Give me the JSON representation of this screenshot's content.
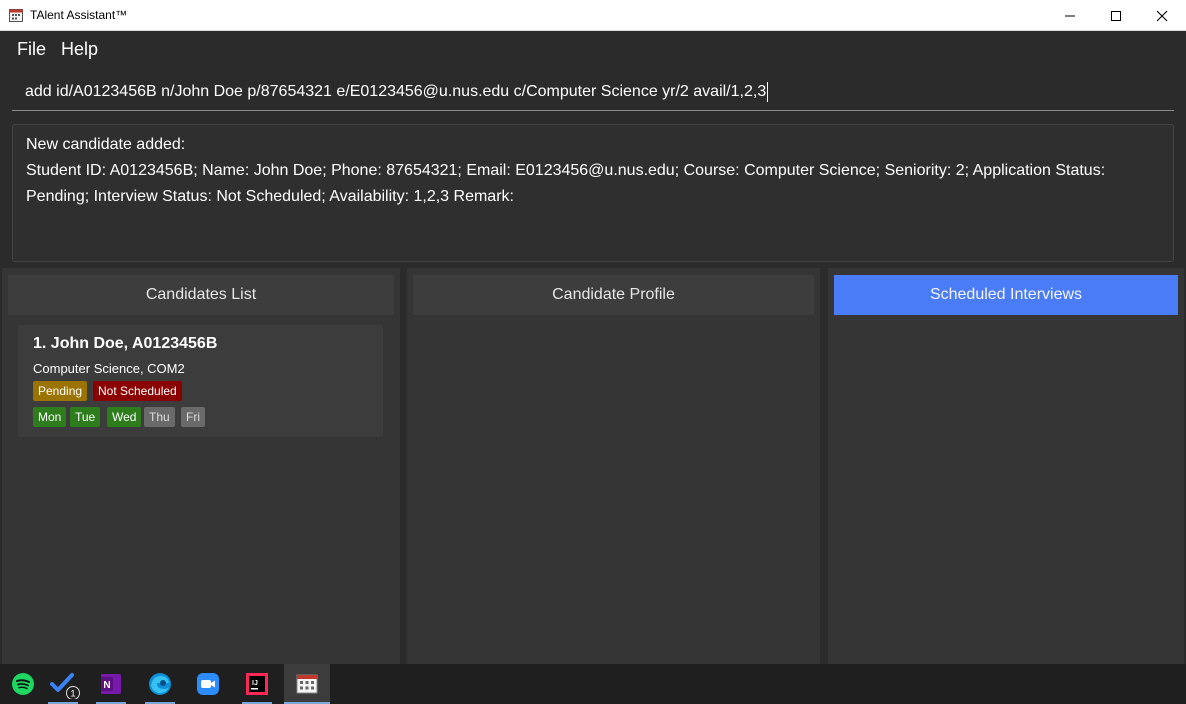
{
  "window": {
    "title": "TAlent Assistant™"
  },
  "menu": {
    "file": "File",
    "help": "Help"
  },
  "command": {
    "value": "add id/A0123456B n/John Doe p/87654321 e/E0123456@u.nus.edu c/Computer Science yr/2 avail/1,2,3"
  },
  "result": {
    "line1": "New candidate added:",
    "line2": "Student ID: A0123456B; Name: John Doe; Phone: 87654321; Email: E0123456@u.nus.edu; Course: Computer Science; Seniority: 2; Application Status:",
    "line3": "Pending; Interview Status: Not Scheduled; Availability: 1,2,3 Remark:"
  },
  "panels": {
    "candidates_list": "Candidates List",
    "candidate_profile": "Candidate Profile",
    "scheduled_interviews": "Scheduled Interviews"
  },
  "candidates": [
    {
      "name": "1.  John Doe, A0123456B",
      "course": "Computer Science, COM2",
      "application_status": "Pending",
      "interview_status": "Not Scheduled",
      "days": [
        "Mon",
        "Tue",
        "Wed",
        "Thu",
        "Fri"
      ]
    }
  ],
  "colors": {
    "pending": "#9a7300",
    "not_scheduled": "#8b0000",
    "available_day": "#2e7d1c",
    "unavailable_day": "#6a6a6a",
    "accent": "#4a7cf8"
  },
  "taskbar": {
    "items": [
      "spotify-icon",
      "todo-icon",
      "onenote-icon",
      "edge-icon",
      "zoom-icon",
      "intellij-icon",
      "talent-assistant-icon"
    ],
    "todo_badge": "1"
  }
}
